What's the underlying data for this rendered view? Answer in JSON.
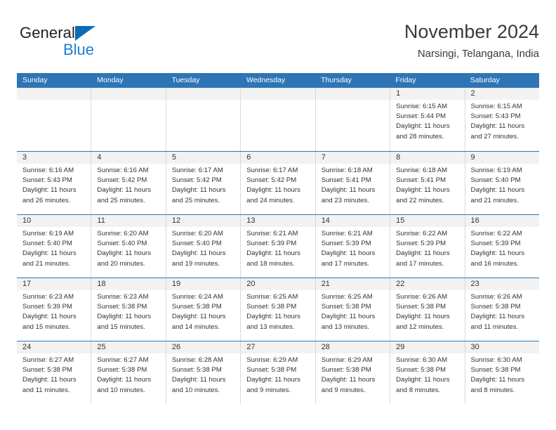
{
  "brand": {
    "name_part1": "General",
    "name_part2": "Blue",
    "triangle_icon": "blue-triangle-icon",
    "color_dark": "#231f20",
    "color_blue": "#1b7fd4"
  },
  "header": {
    "title": "November 2024",
    "subtitle": "Narsingi, Telangana, India"
  },
  "theme": {
    "header_bg": "#2e75b6",
    "header_text": "#ffffff",
    "day_band_bg": "#f2f2f2",
    "row_divider": "#2e75b6",
    "cell_divider": "#d9d9d9",
    "text": "#333333"
  },
  "weekdays": [
    "Sunday",
    "Monday",
    "Tuesday",
    "Wednesday",
    "Thursday",
    "Friday",
    "Saturday"
  ],
  "weeks": [
    {
      "days": [
        {
          "number": "",
          "lines": [],
          "empty": true
        },
        {
          "number": "",
          "lines": [],
          "empty": true
        },
        {
          "number": "",
          "lines": [],
          "empty": true
        },
        {
          "number": "",
          "lines": [],
          "empty": true
        },
        {
          "number": "",
          "lines": [],
          "empty": true
        },
        {
          "number": "1",
          "lines": [
            "Sunrise: 6:15 AM",
            "Sunset: 5:44 PM",
            "Daylight: 11 hours",
            "and 28 minutes."
          ],
          "empty": false
        },
        {
          "number": "2",
          "lines": [
            "Sunrise: 6:15 AM",
            "Sunset: 5:43 PM",
            "Daylight: 11 hours",
            "and 27 minutes."
          ],
          "empty": false
        }
      ]
    },
    {
      "days": [
        {
          "number": "3",
          "lines": [
            "Sunrise: 6:16 AM",
            "Sunset: 5:43 PM",
            "Daylight: 11 hours",
            "and 26 minutes."
          ],
          "empty": false
        },
        {
          "number": "4",
          "lines": [
            "Sunrise: 6:16 AM",
            "Sunset: 5:42 PM",
            "Daylight: 11 hours",
            "and 25 minutes."
          ],
          "empty": false
        },
        {
          "number": "5",
          "lines": [
            "Sunrise: 6:17 AM",
            "Sunset: 5:42 PM",
            "Daylight: 11 hours",
            "and 25 minutes."
          ],
          "empty": false
        },
        {
          "number": "6",
          "lines": [
            "Sunrise: 6:17 AM",
            "Sunset: 5:42 PM",
            "Daylight: 11 hours",
            "and 24 minutes."
          ],
          "empty": false
        },
        {
          "number": "7",
          "lines": [
            "Sunrise: 6:18 AM",
            "Sunset: 5:41 PM",
            "Daylight: 11 hours",
            "and 23 minutes."
          ],
          "empty": false
        },
        {
          "number": "8",
          "lines": [
            "Sunrise: 6:18 AM",
            "Sunset: 5:41 PM",
            "Daylight: 11 hours",
            "and 22 minutes."
          ],
          "empty": false
        },
        {
          "number": "9",
          "lines": [
            "Sunrise: 6:19 AM",
            "Sunset: 5:40 PM",
            "Daylight: 11 hours",
            "and 21 minutes."
          ],
          "empty": false
        }
      ]
    },
    {
      "days": [
        {
          "number": "10",
          "lines": [
            "Sunrise: 6:19 AM",
            "Sunset: 5:40 PM",
            "Daylight: 11 hours",
            "and 21 minutes."
          ],
          "empty": false
        },
        {
          "number": "11",
          "lines": [
            "Sunrise: 6:20 AM",
            "Sunset: 5:40 PM",
            "Daylight: 11 hours",
            "and 20 minutes."
          ],
          "empty": false
        },
        {
          "number": "12",
          "lines": [
            "Sunrise: 6:20 AM",
            "Sunset: 5:40 PM",
            "Daylight: 11 hours",
            "and 19 minutes."
          ],
          "empty": false
        },
        {
          "number": "13",
          "lines": [
            "Sunrise: 6:21 AM",
            "Sunset: 5:39 PM",
            "Daylight: 11 hours",
            "and 18 minutes."
          ],
          "empty": false
        },
        {
          "number": "14",
          "lines": [
            "Sunrise: 6:21 AM",
            "Sunset: 5:39 PM",
            "Daylight: 11 hours",
            "and 17 minutes."
          ],
          "empty": false
        },
        {
          "number": "15",
          "lines": [
            "Sunrise: 6:22 AM",
            "Sunset: 5:39 PM",
            "Daylight: 11 hours",
            "and 17 minutes."
          ],
          "empty": false
        },
        {
          "number": "16",
          "lines": [
            "Sunrise: 6:22 AM",
            "Sunset: 5:39 PM",
            "Daylight: 11 hours",
            "and 16 minutes."
          ],
          "empty": false
        }
      ]
    },
    {
      "days": [
        {
          "number": "17",
          "lines": [
            "Sunrise: 6:23 AM",
            "Sunset: 5:39 PM",
            "Daylight: 11 hours",
            "and 15 minutes."
          ],
          "empty": false
        },
        {
          "number": "18",
          "lines": [
            "Sunrise: 6:23 AM",
            "Sunset: 5:38 PM",
            "Daylight: 11 hours",
            "and 15 minutes."
          ],
          "empty": false
        },
        {
          "number": "19",
          "lines": [
            "Sunrise: 6:24 AM",
            "Sunset: 5:38 PM",
            "Daylight: 11 hours",
            "and 14 minutes."
          ],
          "empty": false
        },
        {
          "number": "20",
          "lines": [
            "Sunrise: 6:25 AM",
            "Sunset: 5:38 PM",
            "Daylight: 11 hours",
            "and 13 minutes."
          ],
          "empty": false
        },
        {
          "number": "21",
          "lines": [
            "Sunrise: 6:25 AM",
            "Sunset: 5:38 PM",
            "Daylight: 11 hours",
            "and 13 minutes."
          ],
          "empty": false
        },
        {
          "number": "22",
          "lines": [
            "Sunrise: 6:26 AM",
            "Sunset: 5:38 PM",
            "Daylight: 11 hours",
            "and 12 minutes."
          ],
          "empty": false
        },
        {
          "number": "23",
          "lines": [
            "Sunrise: 6:26 AM",
            "Sunset: 5:38 PM",
            "Daylight: 11 hours",
            "and 11 minutes."
          ],
          "empty": false
        }
      ]
    },
    {
      "days": [
        {
          "number": "24",
          "lines": [
            "Sunrise: 6:27 AM",
            "Sunset: 5:38 PM",
            "Daylight: 11 hours",
            "and 11 minutes."
          ],
          "empty": false
        },
        {
          "number": "25",
          "lines": [
            "Sunrise: 6:27 AM",
            "Sunset: 5:38 PM",
            "Daylight: 11 hours",
            "and 10 minutes."
          ],
          "empty": false
        },
        {
          "number": "26",
          "lines": [
            "Sunrise: 6:28 AM",
            "Sunset: 5:38 PM",
            "Daylight: 11 hours",
            "and 10 minutes."
          ],
          "empty": false
        },
        {
          "number": "27",
          "lines": [
            "Sunrise: 6:29 AM",
            "Sunset: 5:38 PM",
            "Daylight: 11 hours",
            "and 9 minutes."
          ],
          "empty": false
        },
        {
          "number": "28",
          "lines": [
            "Sunrise: 6:29 AM",
            "Sunset: 5:38 PM",
            "Daylight: 11 hours",
            "and 9 minutes."
          ],
          "empty": false
        },
        {
          "number": "29",
          "lines": [
            "Sunrise: 6:30 AM",
            "Sunset: 5:38 PM",
            "Daylight: 11 hours",
            "and 8 minutes."
          ],
          "empty": false
        },
        {
          "number": "30",
          "lines": [
            "Sunrise: 6:30 AM",
            "Sunset: 5:38 PM",
            "Daylight: 11 hours",
            "and 8 minutes."
          ],
          "empty": false
        }
      ]
    }
  ]
}
